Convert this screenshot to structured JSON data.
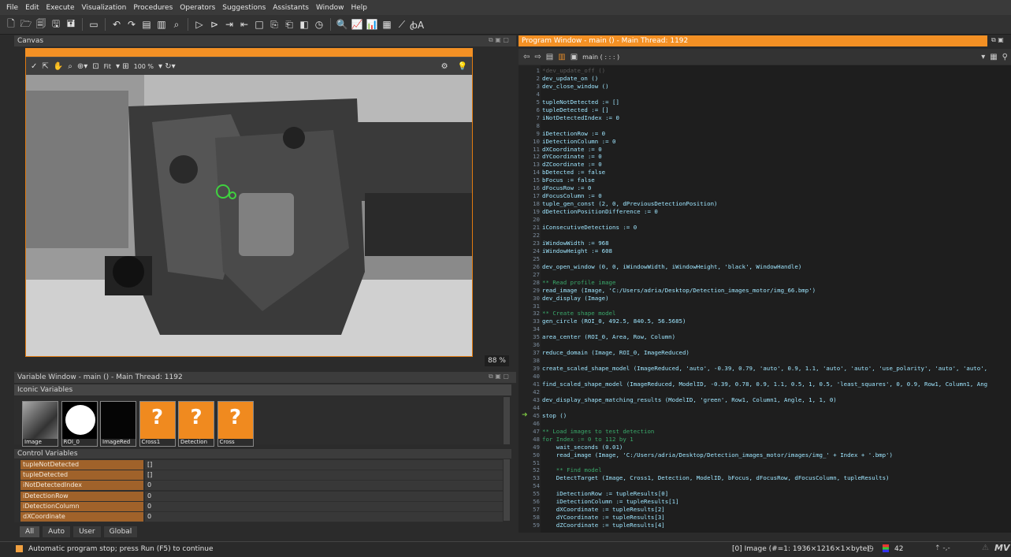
{
  "menu": [
    "File",
    "Edit",
    "Execute",
    "Visualization",
    "Procedures",
    "Operators",
    "Suggestions",
    "Assistants",
    "Window",
    "Help"
  ],
  "canvas": {
    "title": "Canvas",
    "fit_label": "Fit",
    "zoom_label": "100 %",
    "zoom_badge": "88 %"
  },
  "variable_window": {
    "title": "Variable Window - main () - Main Thread: 1192",
    "iconic_title": "Iconic Variables",
    "iconic": [
      {
        "label": "Image",
        "kind": "image"
      },
      {
        "label": "ROI_0",
        "kind": "circle"
      },
      {
        "label": "ImageRed",
        "kind": "dark"
      },
      {
        "label": "Cross1",
        "kind": "unknown"
      },
      {
        "label": "Detection",
        "kind": "unknown"
      },
      {
        "label": "Cross",
        "kind": "unknown"
      }
    ],
    "unknown_glyph": "?",
    "control_title": "Control Variables",
    "control": [
      {
        "name": "tupleNotDetected",
        "value": "[]"
      },
      {
        "name": "tupleDetected",
        "value": "[]"
      },
      {
        "name": "iNotDetectedIndex",
        "value": "0"
      },
      {
        "name": "iDetectionRow",
        "value": "0"
      },
      {
        "name": "iDetectionColumn",
        "value": "0"
      },
      {
        "name": "dXCoordinate",
        "value": "0"
      }
    ],
    "tabs": [
      "All",
      "Auto",
      "User",
      "Global"
    ]
  },
  "program": {
    "title": "Program Window - main () - Main Thread: 1192",
    "procedure": "main ( : : : )",
    "lines": [
      {
        "n": "1",
        "t": "*dev_update_off ()",
        "c": "dim"
      },
      {
        "n": "2",
        "t": "dev_update_on ()",
        "c": ""
      },
      {
        "n": "3",
        "t": "dev_close_window ()",
        "c": ""
      },
      {
        "n": "4",
        "t": "",
        "c": ""
      },
      {
        "n": "5",
        "t": "tupleNotDetected := []",
        "c": ""
      },
      {
        "n": "6",
        "t": "tupleDetected := []",
        "c": ""
      },
      {
        "n": "7",
        "t": "iNotDetectedIndex := 0",
        "c": ""
      },
      {
        "n": "8",
        "t": "",
        "c": ""
      },
      {
        "n": "9",
        "t": "iDetectionRow := 0",
        "c": ""
      },
      {
        "n": "10",
        "t": "iDetectionColumn := 0",
        "c": ""
      },
      {
        "n": "11",
        "t": "dXCoordinate := 0",
        "c": ""
      },
      {
        "n": "12",
        "t": "dYCoordinate := 0",
        "c": ""
      },
      {
        "n": "13",
        "t": "dZCoordinate := 0",
        "c": ""
      },
      {
        "n": "14",
        "t": "bDetected := false",
        "c": ""
      },
      {
        "n": "15",
        "t": "bFocus := false",
        "c": ""
      },
      {
        "n": "16",
        "t": "dFocusRow := 0",
        "c": ""
      },
      {
        "n": "17",
        "t": "dFocusColumn := 0",
        "c": ""
      },
      {
        "n": "18",
        "t": "tuple_gen_const (2, 0, dPreviousDetectionPosition)",
        "c": ""
      },
      {
        "n": "19",
        "t": "dDetectionPositionDifference := 0",
        "c": ""
      },
      {
        "n": "20",
        "t": "",
        "c": ""
      },
      {
        "n": "21",
        "t": "iConsecutiveDetections := 0",
        "c": ""
      },
      {
        "n": "22",
        "t": "",
        "c": ""
      },
      {
        "n": "23",
        "t": "iWindowWidth := 968",
        "c": ""
      },
      {
        "n": "24",
        "t": "iWindowHeight := 608",
        "c": ""
      },
      {
        "n": "25",
        "t": "",
        "c": ""
      },
      {
        "n": "26",
        "t": "dev_open_window (0, 0, iWindowWidth, iWindowHeight, 'black', WindowHandle)",
        "c": ""
      },
      {
        "n": "27",
        "t": "",
        "c": ""
      },
      {
        "n": "28",
        "t": "** Read profile image",
        "c": "cm"
      },
      {
        "n": "29",
        "t": "read_image (Image, 'C:/Users/adria/Desktop/Detection_images_motor/img_66.bmp')",
        "c": ""
      },
      {
        "n": "30",
        "t": "dev_display (Image)",
        "c": ""
      },
      {
        "n": "31",
        "t": "",
        "c": ""
      },
      {
        "n": "32",
        "t": "** Create shape model",
        "c": "cm"
      },
      {
        "n": "33",
        "t": "gen_circle (ROI_0, 492.5, 840.5, 56.5685)",
        "c": ""
      },
      {
        "n": "34",
        "t": "",
        "c": ""
      },
      {
        "n": "35",
        "t": "area_center (ROI_0, Area, Row, Column)",
        "c": ""
      },
      {
        "n": "36",
        "t": "",
        "c": ""
      },
      {
        "n": "37",
        "t": "reduce_domain (Image, ROI_0, ImageReduced)",
        "c": ""
      },
      {
        "n": "38",
        "t": "",
        "c": ""
      },
      {
        "n": "39",
        "t": "create_scaled_shape_model (ImageReduced, 'auto', -0.39, 0.79, 'auto', 0.9, 1.1, 'auto', 'auto', 'use_polarity', 'auto', 'auto',",
        "c": ""
      },
      {
        "n": "40",
        "t": "",
        "c": ""
      },
      {
        "n": "41",
        "t": "find_scaled_shape_model (ImageReduced, ModelID, -0.39, 0.78, 0.9, 1.1, 0.5, 1, 0.5, 'least_squares', 0, 0.9, Row1, Column1, Ang",
        "c": ""
      },
      {
        "n": "42",
        "t": "",
        "c": ""
      },
      {
        "n": "43",
        "t": "dev_display_shape_matching_results (ModelID, 'green', Row1, Column1, Angle, 1, 1, 0)",
        "c": ""
      },
      {
        "n": "44",
        "t": "",
        "c": ""
      },
      {
        "n": "45",
        "t": "stop ()",
        "c": ""
      },
      {
        "n": "46",
        "t": "",
        "c": ""
      },
      {
        "n": "47",
        "t": "** Load images to test detection",
        "c": "cm"
      },
      {
        "n": "48",
        "t": "for Index := 0 to 112 by 1",
        "c": "kw"
      },
      {
        "n": "49",
        "t": "    wait_seconds (0.01)",
        "c": ""
      },
      {
        "n": "50",
        "t": "    read_image (Image, 'C:/Users/adria/Desktop/Detection_images_motor/images/img_' + Index + '.bmp')",
        "c": ""
      },
      {
        "n": "51",
        "t": "",
        "c": ""
      },
      {
        "n": "52",
        "t": "    ** Find model",
        "c": "cm"
      },
      {
        "n": "53",
        "t": "    DetectTarget (Image, Cross1, Detection, ModelID, bFocus, dFocusRow, dFocusColumn, tupleResults)",
        "c": ""
      },
      {
        "n": "54",
        "t": "",
        "c": ""
      },
      {
        "n": "55",
        "t": "    iDetectionRow := tupleResults[0]",
        "c": ""
      },
      {
        "n": "56",
        "t": "    iDetectionColumn := tupleResults[1]",
        "c": ""
      },
      {
        "n": "57",
        "t": "    dXCoordinate := tupleResults[2]",
        "c": ""
      },
      {
        "n": "58",
        "t": "    dYCoordinate := tupleResults[3]",
        "c": ""
      },
      {
        "n": "59",
        "t": "    dZCoordinate := tupleResults[4]",
        "c": ""
      }
    ]
  },
  "status": {
    "message": "Automatic program stop; press Run (F5) to continue",
    "image_info": "[0] Image (#=1: 1936×1216×1×byte)",
    "count": "42"
  }
}
